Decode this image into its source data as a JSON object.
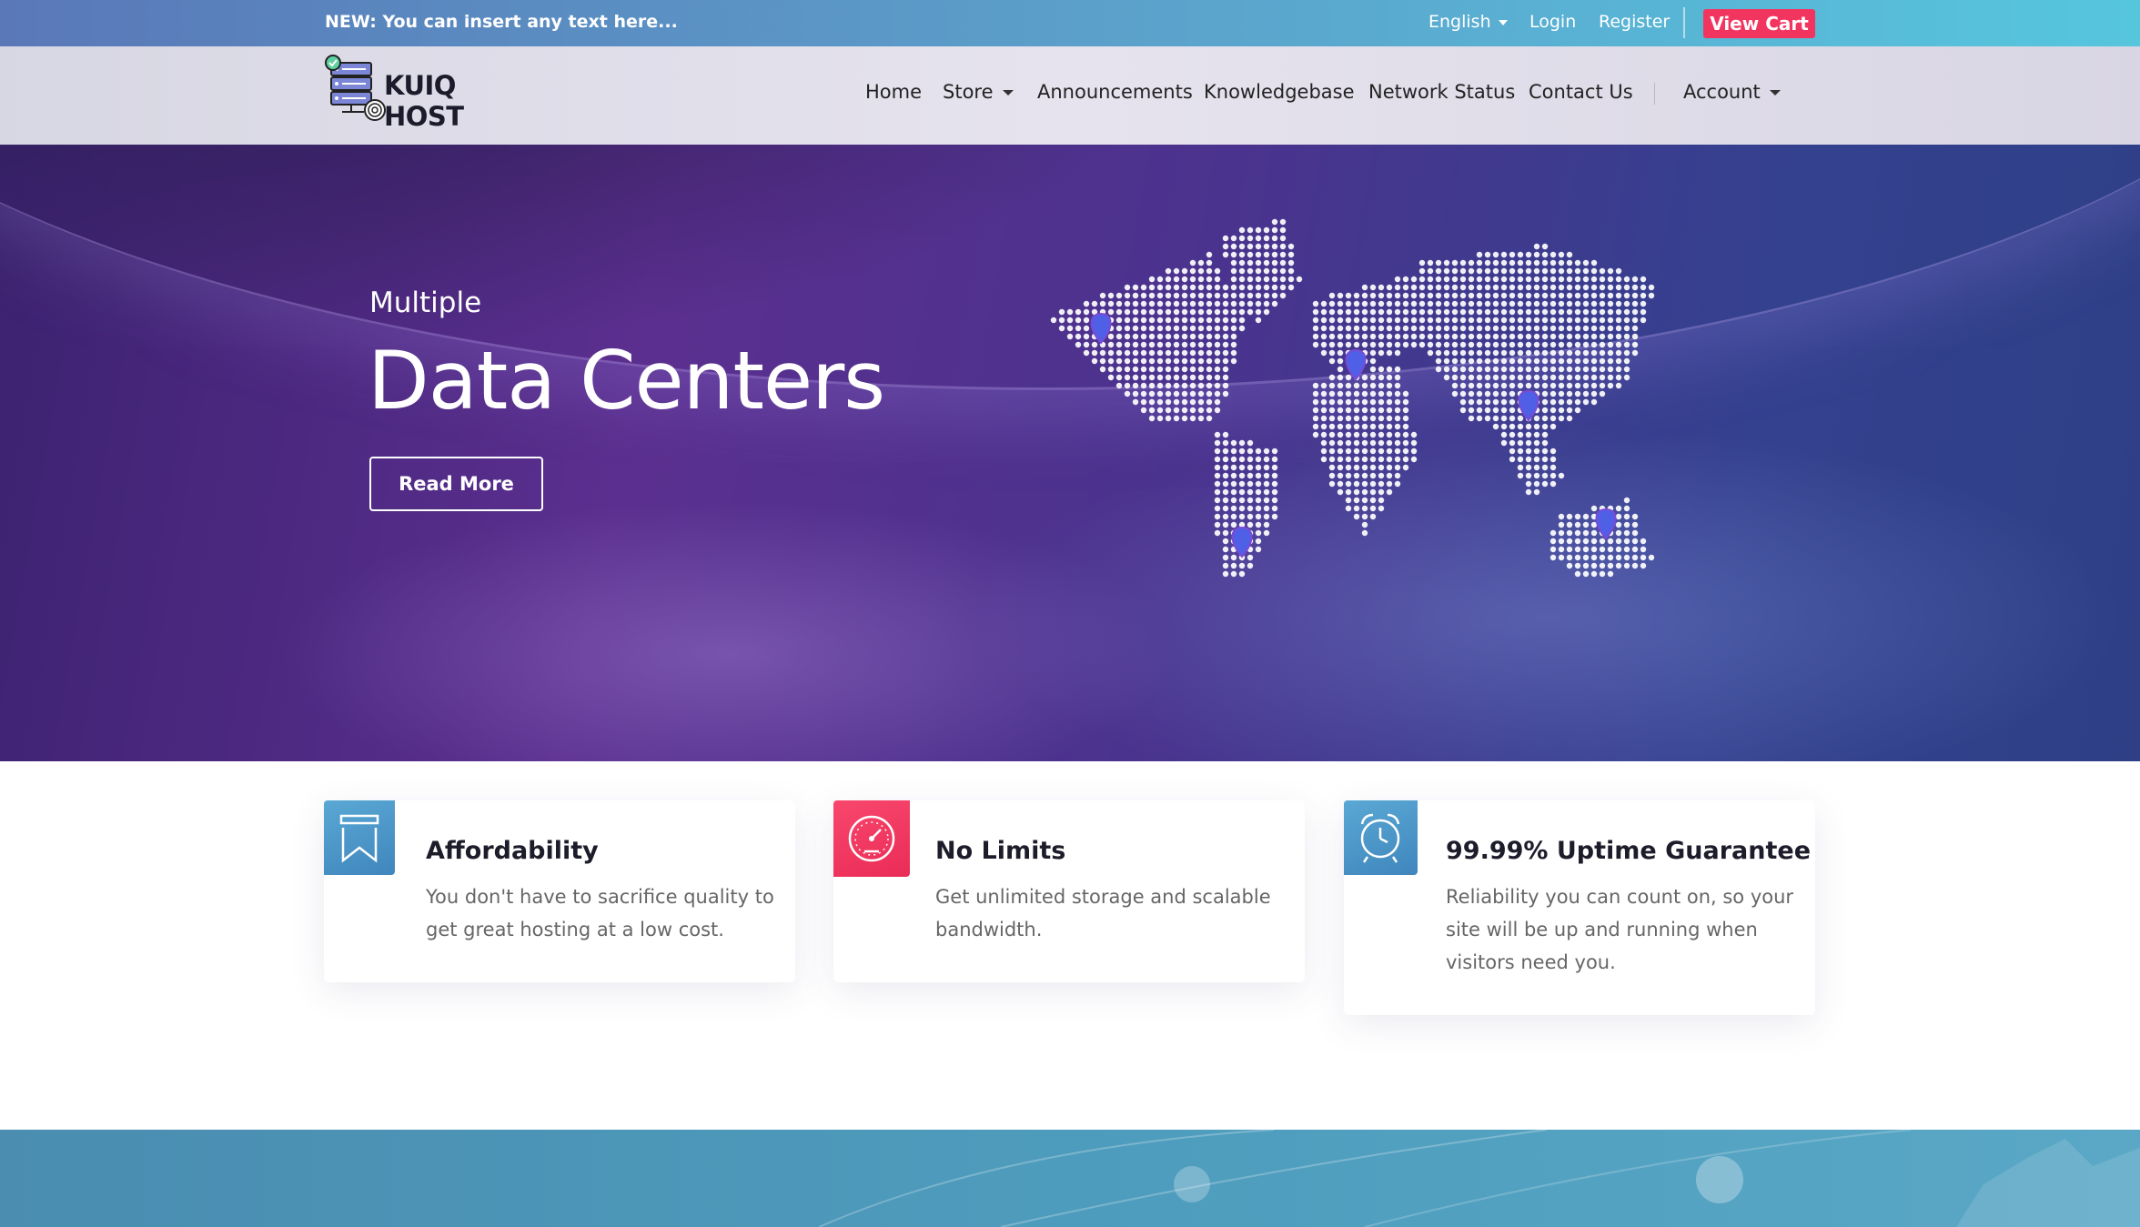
{
  "topbar": {
    "notice": "NEW: You can insert any text here...",
    "language": "English",
    "login": "Login",
    "register": "Register",
    "view_cart": "View Cart"
  },
  "navbar": {
    "brand": "KUIQ HOST",
    "items": [
      {
        "label": "Home"
      },
      {
        "label": "Store"
      },
      {
        "label": "Announcements"
      },
      {
        "label": "Knowledgebase"
      },
      {
        "label": "Network Status"
      },
      {
        "label": "Contact Us"
      }
    ],
    "account": "Account"
  },
  "hero": {
    "subtitle": "Multiple",
    "title": "Data Centers",
    "button": "Read More"
  },
  "features": [
    {
      "title": "Affordability",
      "description": "You don't have to sacrifice quality to get great hosting at a low cost.",
      "icon": "bookmark-icon",
      "color": "#4a9cc7"
    },
    {
      "title": "No Limits",
      "description": "Get unlimited storage and scalable bandwidth.",
      "icon": "speedometer-icon",
      "color": "#f2355f"
    },
    {
      "title": "99.99% Uptime Guarantee",
      "description": "Reliability you can count on, so your site will be up and running when visitors need you.",
      "icon": "alarm-clock-icon",
      "color": "#4a9cc7"
    }
  ],
  "colors": {
    "accent": "#f2355f",
    "topbar_start": "#5a78b8",
    "topbar_end": "#56c6dd",
    "hero_purple": "#5b2f8f"
  }
}
